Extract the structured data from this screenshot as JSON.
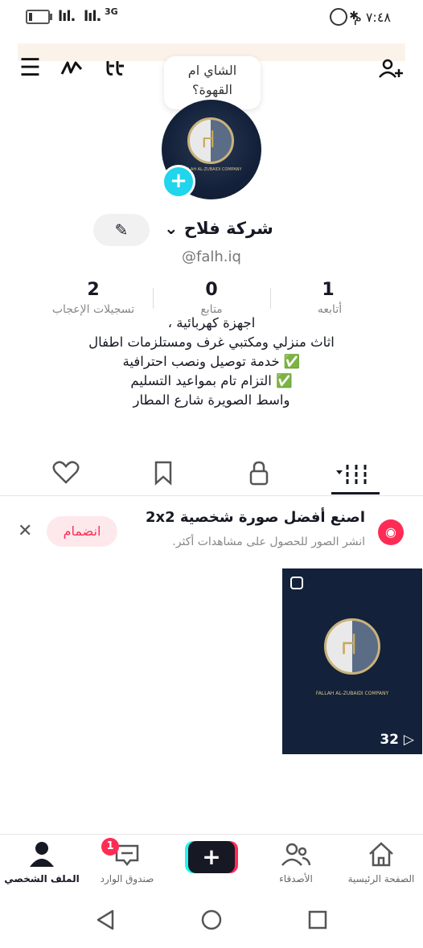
{
  "status_bar": {
    "time": "٧:٤٨ م",
    "network": "3G",
    "signal_1": "lıl.",
    "signal_2": "lıl.",
    "bluetooth_glyph": "✱"
  },
  "top_nav": {
    "menu_glyph": "☰",
    "scribble_glyph": "⌇",
    "footprint_glyph": "👣",
    "add_friend_glyph": "⊹"
  },
  "note_bubble": {
    "line1": "الشاي ام",
    "line2": "القهوة؟"
  },
  "avatar_logo": {
    "caption": "FALLAH AL-ZUBAIDI COMPANY"
  },
  "profile": {
    "name": "شركة فلاح",
    "dropdown_glyph": "⌄",
    "handle": "@falh.iq",
    "edit_glyph": "✎"
  },
  "stats": {
    "likes_count": "2",
    "likes_label": "تسجيلات الإعجاب",
    "followers_count": "0",
    "followers_label": "متابع",
    "following_count": "1",
    "following_label": "أتابعه"
  },
  "bio": {
    "line1": "اجهزة كهربائية ،",
    "line2": "اثاث منزلي ومكتبي غرف ومستلزمات اطفال",
    "line3": "✅ خدمة توصيل ونصب احترافية",
    "line4": "✅ التزام تام بمواعيد التسليم",
    "line5": "واسط الصويرة شارع المطار"
  },
  "tabs": {
    "videos_glyph": "▾ǀǀǀ",
    "private_glyph": "🔒",
    "saved_glyph": "🔖",
    "liked_glyph": "♡"
  },
  "promo": {
    "title": "اصنع أفضل صورة شخصية 2x2",
    "subtitle": "انشر الصور للحصول على مشاهدات أكثر.",
    "join_label": "انضمام",
    "close_glyph": "✕"
  },
  "video": {
    "views": "32 ▷"
  },
  "bottom_nav": {
    "home_label": "الصفحة الرئيسية",
    "friends_label": "الأصدقاء",
    "create_glyph": "+",
    "inbox_label": "صندوق الوارد",
    "inbox_badge": "1",
    "profile_label": "الملف الشخصي"
  },
  "colors": {
    "accent_red": "#fe2c55",
    "accent_cyan": "#20d5ec",
    "text_dark": "#161823"
  }
}
